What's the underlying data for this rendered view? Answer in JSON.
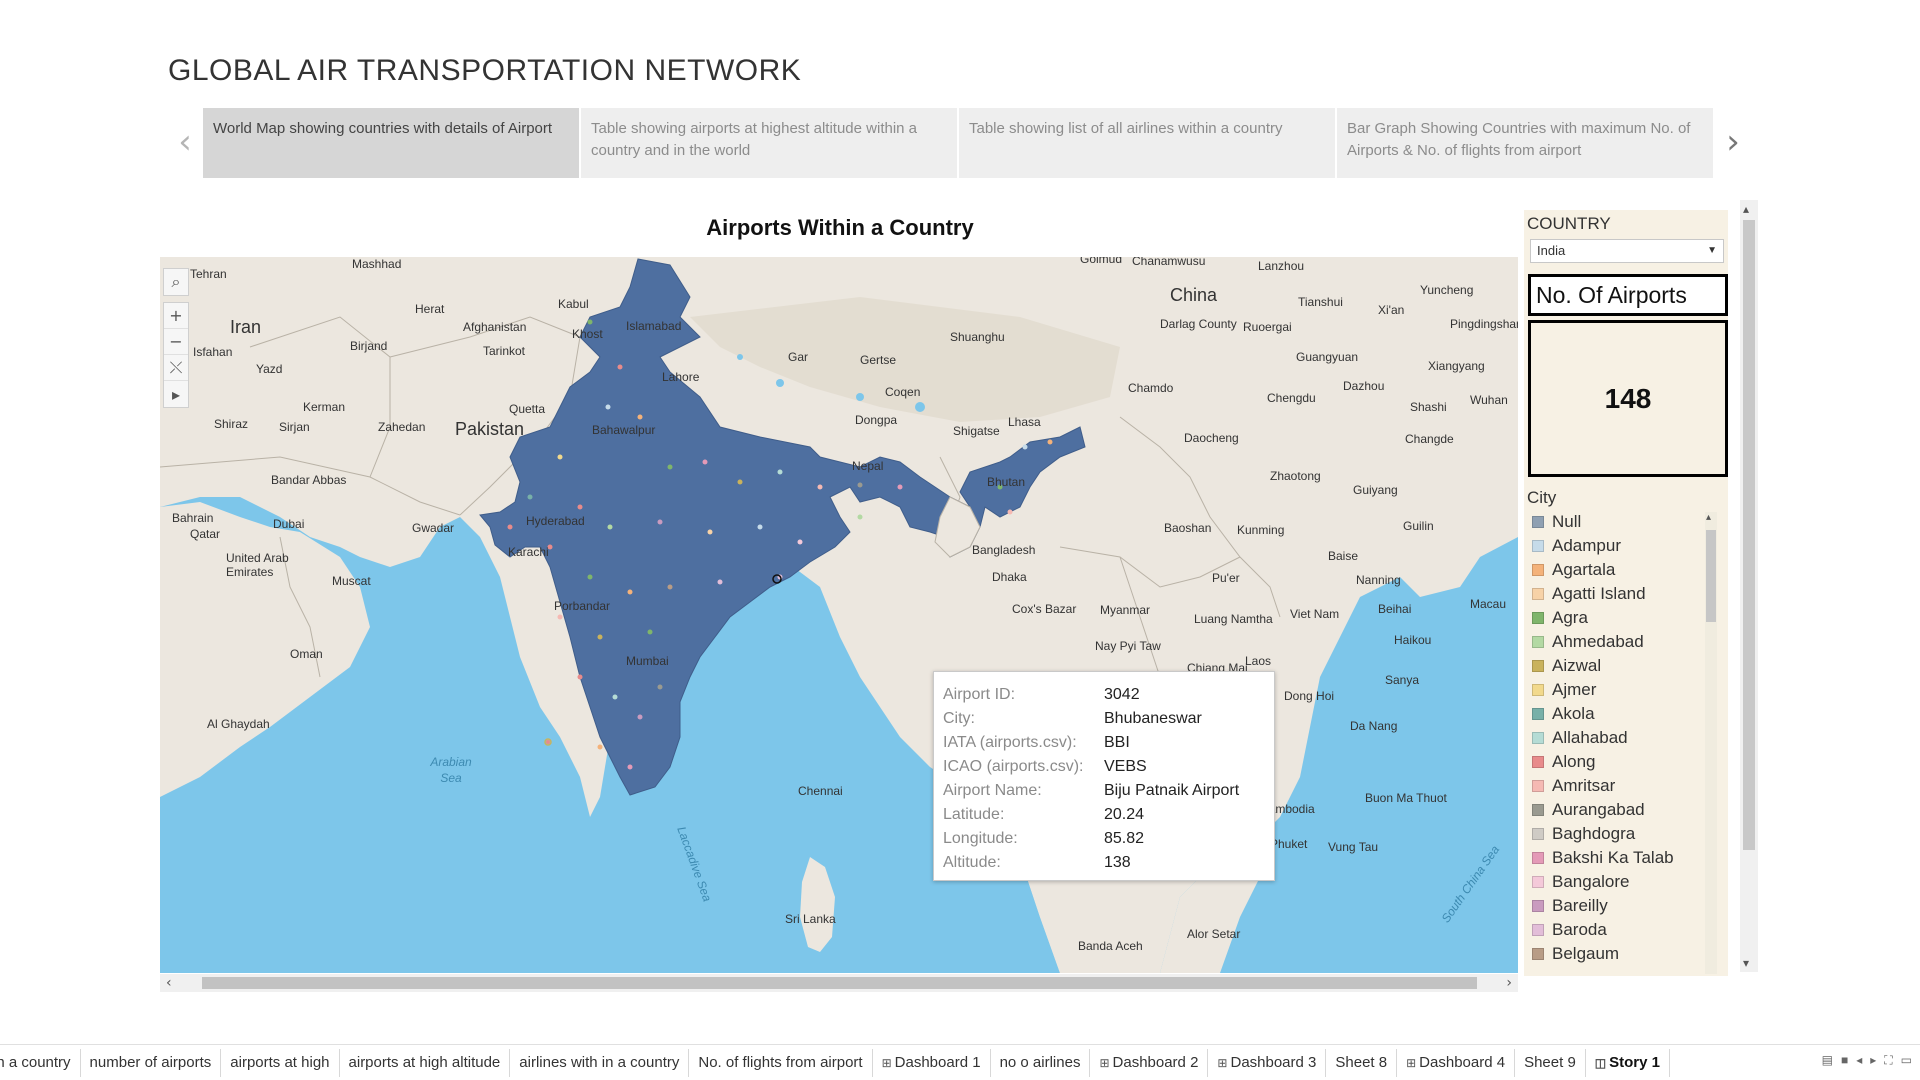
{
  "story": {
    "title": "GLOBAL AIR TRANSPORTATION NETWORK",
    "prev_icon": "chevron-left-icon",
    "next_icon": "chevron-right-icon",
    "points": [
      {
        "label": "World Map showing countries with details of Airport",
        "active": true
      },
      {
        "label": "Table showing airports at highest altitude within a country and in the world",
        "active": false
      },
      {
        "label": "Table showing list of all airlines within a country",
        "active": false
      },
      {
        "label": "Bar Graph Showing Countries with maximum No. of Airports & No. of flights from airport",
        "active": false
      }
    ]
  },
  "sheet": {
    "title": "Airports Within a Country"
  },
  "map": {
    "labels": {
      "country_labels": [
        "Iran",
        "Pakistan",
        "China",
        "Nepal",
        "Bhutan",
        "Bangladesh",
        "Myanmar",
        "Laos",
        "Viet Nam",
        "Oman",
        "Afghanistan",
        "Sri Lanka",
        "Cambodia"
      ],
      "city_labels": [
        "Tehran",
        "Mashhad",
        "Herat",
        "Kabul",
        "Islamabad",
        "Khost",
        "Isfahan",
        "Yazd",
        "Birjand",
        "Tarinkot",
        "Kerman",
        "Zahedan",
        "Quetta",
        "Shiraz",
        "Sirjan",
        "Bahawalpur",
        "Bandar Abbas",
        "Lahore",
        "Gar",
        "Gertse",
        "Coqen",
        "Dongpa",
        "Shigatse",
        "Lhasa",
        "Shuanghu",
        "Golmud",
        "Chanamwusu",
        "Lanzhou",
        "Tianshui",
        "Xi'an",
        "Yuncheng",
        "Pingdingshan",
        "Darlag County",
        "Ruoergai",
        "Guangyuan",
        "Xiangyang",
        "Dazhou",
        "Chengdu",
        "Chamdo",
        "Shashi",
        "Wuhan",
        "Changde",
        "Daocheng",
        "Zhaotong",
        "Guiyang",
        "Kunming",
        "Baoshan",
        "Guilin",
        "Baise",
        "Nanning",
        "Beihai",
        "Macau",
        "Haikou",
        "Sanya",
        "Pu'er",
        "Luang Namtha",
        "Nay Pyi Taw",
        "Chiang Mai",
        "Dong Hoi",
        "Da Nang",
        "Buon Ma Thuot",
        "Vung Tau",
        "Phuket",
        "Alor Setar",
        "Banda Aceh",
        "Bahrain",
        "Qatar",
        "Dubai",
        "Gwadar",
        "Hyderabad",
        "Karachi",
        "Muscat",
        "United Arab Emirates",
        "Al Ghaydah",
        "Dhaka",
        "Cox's Bazar",
        "Chennai",
        "Mumbai",
        "Porbandar"
      ],
      "sea_labels": [
        "Arabian Sea",
        "Laccadive Sea",
        "South China Sea"
      ]
    },
    "tools": {
      "search": "search-icon",
      "zoom_in": "+",
      "zoom_out": "−",
      "reset": "reset-icon",
      "expand": "play-icon"
    },
    "colors": {
      "water": "#7dc6ea",
      "land": "#ece7df",
      "highlight": "#4e6fa0"
    }
  },
  "tooltip": {
    "rows": [
      {
        "key": "Airport ID:",
        "value": "3042"
      },
      {
        "key": "City:",
        "value": "Bhubaneswar"
      },
      {
        "key": "IATA (airports.csv):",
        "value": "BBI"
      },
      {
        "key": "ICAO (airports.csv):",
        "value": "VEBS"
      },
      {
        "key": "Airport Name:",
        "value": "Biju Patnaik Airport"
      },
      {
        "key": "Latitude:",
        "value": "20.24"
      },
      {
        "key": "Longitude:",
        "value": "85.82"
      },
      {
        "key": "Altitude:",
        "value": "138"
      }
    ]
  },
  "filters": {
    "country_title": "COUNTRY",
    "country_value": "India",
    "count_header": "No. Of Airports",
    "count_value": "148",
    "legend_title": "City",
    "legend": [
      {
        "label": "Null",
        "color": "#8fa0b2"
      },
      {
        "label": "Adampur",
        "color": "#c6dbe9"
      },
      {
        "label": "Agartala",
        "color": "#f4b27a"
      },
      {
        "label": "Agatti Island",
        "color": "#f7d2a7"
      },
      {
        "label": "Agra",
        "color": "#7fb56b"
      },
      {
        "label": "Ahmedabad",
        "color": "#b3d9a3"
      },
      {
        "label": "Aizwal",
        "color": "#c9b25c"
      },
      {
        "label": "Ajmer",
        "color": "#f2d98c"
      },
      {
        "label": "Akola",
        "color": "#78b0a8"
      },
      {
        "label": "Allahabad",
        "color": "#b5dcd5"
      },
      {
        "label": "Along",
        "color": "#e88b8b"
      },
      {
        "label": "Amritsar",
        "color": "#f5b9b3"
      },
      {
        "label": "Aurangabad",
        "color": "#9a9a90"
      },
      {
        "label": "Baghdogra",
        "color": "#cfcbc5"
      },
      {
        "label": "Bakshi Ka Talab",
        "color": "#e49ab7"
      },
      {
        "label": "Bangalore",
        "color": "#f4c9d9"
      },
      {
        "label": "Bareilly",
        "color": "#c99bbf"
      },
      {
        "label": "Baroda",
        "color": "#e2bdd8"
      },
      {
        "label": "Belgaum",
        "color": "#b89c86"
      }
    ]
  },
  "tabs": [
    {
      "label": "in a country",
      "icon": "",
      "active": false
    },
    {
      "label": "number of airports",
      "icon": "",
      "active": false
    },
    {
      "label": "airports at high",
      "icon": "",
      "active": false
    },
    {
      "label": "airports at high altitude",
      "icon": "",
      "active": false
    },
    {
      "label": "airlines  with in a country",
      "icon": "",
      "active": false
    },
    {
      "label": "No. of flights from airport",
      "icon": "",
      "active": false
    },
    {
      "label": "Dashboard 1",
      "icon": "dashboard-icon",
      "active": false
    },
    {
      "label": "no o airlines",
      "icon": "",
      "active": false
    },
    {
      "label": "Dashboard 2",
      "icon": "dashboard-icon",
      "active": false
    },
    {
      "label": "Dashboard 3",
      "icon": "dashboard-icon",
      "active": false
    },
    {
      "label": "Sheet 8",
      "icon": "",
      "active": false
    },
    {
      "label": "Dashboard 4",
      "icon": "dashboard-icon",
      "active": false
    },
    {
      "label": "Sheet 9",
      "icon": "",
      "active": false
    },
    {
      "label": "Story 1",
      "icon": "story-icon",
      "active": true
    }
  ]
}
